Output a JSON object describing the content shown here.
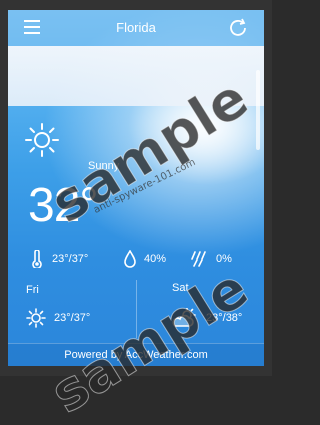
{
  "header": {
    "city": "Florida",
    "menu_icon": "hamburger-menu-icon",
    "refresh_icon": "refresh-icon"
  },
  "current": {
    "condition": "Sunny",
    "temperature": "32°",
    "icon": "sun-icon"
  },
  "details": {
    "temp_range": "23°/37°",
    "humidity": "40%",
    "precip": "0%"
  },
  "forecast": [
    {
      "day": "Fri",
      "range": "23°/37°",
      "icon": "sun-icon"
    },
    {
      "day": "Sat",
      "range": "23°/38°",
      "icon": "partly-cloudy-icon"
    }
  ],
  "footer": {
    "text": "Powered by AccWeather.com"
  },
  "watermark": {
    "word": "sample",
    "url": "anti-spyware-101.com"
  },
  "colors": {
    "sky_top": "#7cc4f3",
    "sky_bottom": "#2b86db"
  }
}
